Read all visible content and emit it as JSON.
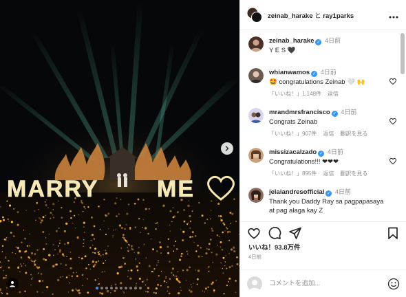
{
  "post": {
    "author": "zeinab_harake",
    "connector": "と",
    "collaborator": "ray1parks",
    "more_icon": "more-horizontal-icon",
    "image": {
      "sign_word_1": "MARRY",
      "sign_word_2": "ME",
      "carousel_count": 10,
      "carousel_active": 1
    }
  },
  "caption": {
    "user": "zeinab_harake",
    "time": "4日前",
    "text": "Y E S 🖤"
  },
  "comments": [
    {
      "user": "whianwamos",
      "time": "4日前",
      "text": "🤩 congratulations Zeinab 🤍 🙌",
      "likes": "「いいね！」1,148件",
      "reply": "返信",
      "translate": ""
    },
    {
      "user": "mrandmrsfrancisco",
      "time": "4日前",
      "text": "Congrats Zeinab",
      "likes": "「いいね！」907件",
      "reply": "返信",
      "translate": "翻訳を見る"
    },
    {
      "user": "missizacalzado",
      "time": "4日前",
      "text": "Congratulations!!! ❤❤❤",
      "likes": "「いいね！」895件",
      "reply": "返信",
      "translate": "翻訳を見る"
    },
    {
      "user": "jelaiandresofficial",
      "time": "4日前",
      "text": "Thank you Daddy Ray sa pagpapasaya at pag alaga kay Z",
      "likes": "",
      "reply": "",
      "translate": ""
    }
  ],
  "actions": {
    "likes_text": "いいね！93.8万件",
    "date": "4日前"
  },
  "add_comment": {
    "placeholder": "コメントを追加..."
  },
  "colors": {
    "verified": "#3897f0",
    "dot_active": "#3a94ef",
    "muted": "#8e8e8e"
  }
}
